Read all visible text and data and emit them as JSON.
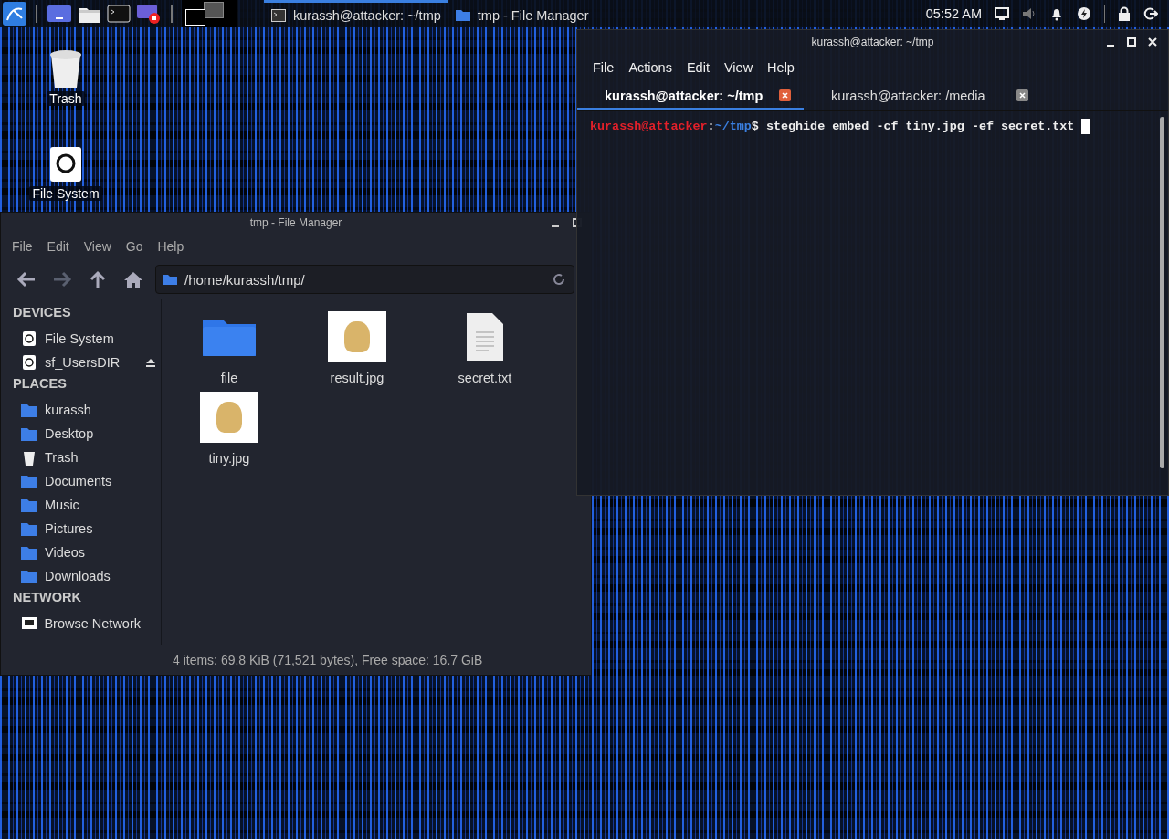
{
  "panel": {
    "workspaces": [
      {
        "selected": true
      },
      {
        "selected": false
      }
    ],
    "tasks": [
      {
        "label": "kurassh@attacker: ~/tmp",
        "kind": "terminal",
        "selected": true
      },
      {
        "label": "tmp - File Manager",
        "kind": "folder",
        "selected": false
      }
    ],
    "clock": "05:52 AM"
  },
  "desktop_icons": [
    {
      "label": "Trash",
      "kind": "trash"
    },
    {
      "label": "File System",
      "kind": "drive"
    }
  ],
  "file_manager": {
    "title": "tmp - File Manager",
    "menu": [
      "File",
      "Edit",
      "View",
      "Go",
      "Help"
    ],
    "location": "/home/kurassh/tmp/",
    "sidebar": [
      {
        "heading": "DEVICES",
        "items": [
          {
            "label": "File System",
            "kind": "drive",
            "ejectable": false
          },
          {
            "label": "sf_UsersDIR",
            "kind": "share",
            "ejectable": true
          }
        ]
      },
      {
        "heading": "PLACES",
        "items": [
          {
            "label": "kurassh",
            "kind": "home",
            "ejectable": false
          },
          {
            "label": "Desktop",
            "kind": "desktop",
            "ejectable": false
          },
          {
            "label": "Trash",
            "kind": "trash",
            "ejectable": false
          },
          {
            "label": "Documents",
            "kind": "documents",
            "ejectable": false
          },
          {
            "label": "Music",
            "kind": "music",
            "ejectable": false
          },
          {
            "label": "Pictures",
            "kind": "pictures",
            "ejectable": false
          },
          {
            "label": "Videos",
            "kind": "videos",
            "ejectable": false
          },
          {
            "label": "Downloads",
            "kind": "downloads",
            "ejectable": false
          }
        ]
      },
      {
        "heading": "NETWORK",
        "items": [
          {
            "label": "Browse Network",
            "kind": "network",
            "ejectable": false
          }
        ]
      }
    ],
    "files": [
      {
        "name": "file",
        "kind": "folder"
      },
      {
        "name": "result.jpg",
        "kind": "image"
      },
      {
        "name": "secret.txt",
        "kind": "text"
      },
      {
        "name": "tiny.jpg",
        "kind": "image"
      }
    ],
    "status": "4 items: 69.8 KiB (71,521 bytes), Free space: 16.7 GiB"
  },
  "terminal": {
    "title": "kurassh@attacker: ~/tmp",
    "menu": [
      "File",
      "Actions",
      "Edit",
      "View",
      "Help"
    ],
    "tabs": [
      {
        "label": "kurassh@attacker: ~/tmp",
        "selected": true
      },
      {
        "label": "kurassh@attacker: /media",
        "selected": false
      }
    ],
    "prompt": {
      "user": "kurassh@attacker",
      "separator": ":",
      "path": "~/tmp",
      "symbol": "$",
      "command": "steghide embed -cf tiny.jpg -ef secret.txt"
    }
  }
}
